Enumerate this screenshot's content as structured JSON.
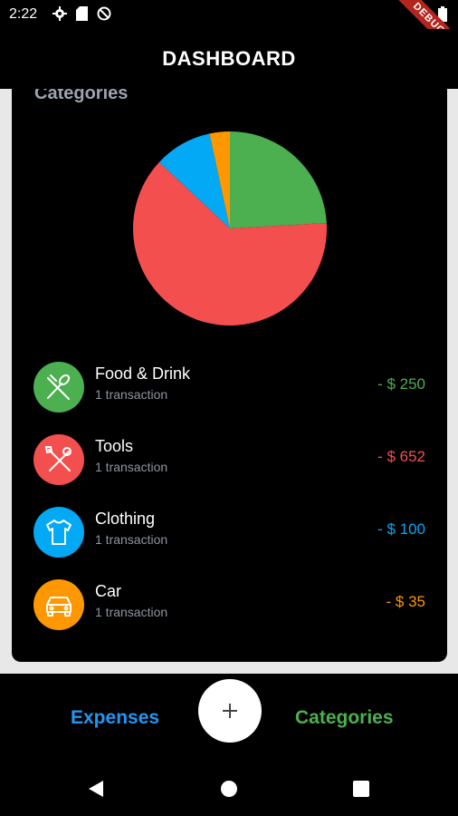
{
  "status_bar": {
    "time": "2:22",
    "debug_label": "DEBUG",
    "icons": [
      "gear-icon",
      "sd-card-icon",
      "no-disturb-icon",
      "wifi-icon",
      "battery-icon"
    ]
  },
  "app_bar": {
    "title": "DASHBOARD"
  },
  "card": {
    "title": "Categories"
  },
  "chart_data": {
    "type": "pie",
    "title": "",
    "slices": [
      {
        "label": "Food & Drink",
        "value": 250,
        "color": "#4caf50"
      },
      {
        "label": "Tools",
        "value": 652,
        "color": "#f44f4f"
      },
      {
        "label": "Clothing",
        "value": 100,
        "color": "#03a9f4"
      },
      {
        "label": "Car",
        "value": 35,
        "color": "#ff9800"
      }
    ]
  },
  "categories": [
    {
      "name": "Food & Drink",
      "subtitle": "1 transaction",
      "amount": "- $ 250",
      "color": "#4caf50",
      "icon": "utensils-icon"
    },
    {
      "name": "Tools",
      "subtitle": "1 transaction",
      "amount": "- $ 652",
      "color": "#f44f4f",
      "icon": "tools-icon"
    },
    {
      "name": "Clothing",
      "subtitle": "1 transaction",
      "amount": "- $ 100",
      "color": "#03a9f4",
      "icon": "shirt-icon"
    },
    {
      "name": "Car",
      "subtitle": "1 transaction",
      "amount": "- $ 35",
      "color": "#ff9800",
      "icon": "car-icon"
    }
  ],
  "bottom_nav": {
    "left_label": "Expenses",
    "right_label": "Categories",
    "fab_label": "+",
    "left_color": "#2196f3",
    "right_color": "#4caf50"
  }
}
